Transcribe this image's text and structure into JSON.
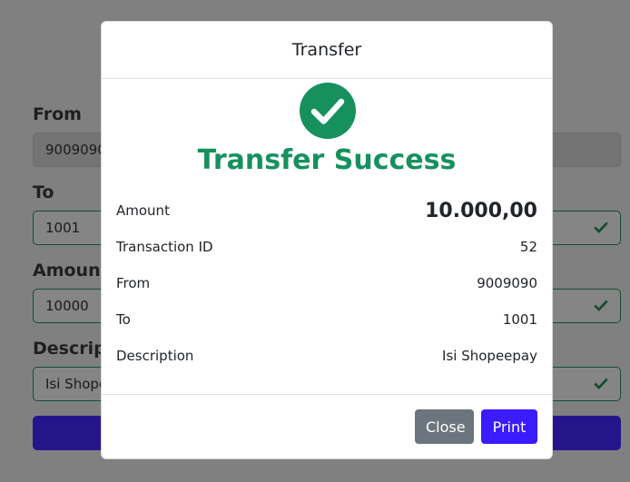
{
  "form": {
    "from_label": "From",
    "from_value": "9009090",
    "to_label": "To",
    "to_value": "1001",
    "amount_label": "Amount",
    "amount_value": "10000",
    "description_label": "Descripti",
    "description_value": "Isi Shope"
  },
  "modal": {
    "title": "Transfer",
    "success_icon": "check-circle-icon",
    "success_text": "Transfer Success",
    "details": {
      "amount_label": "Amount",
      "amount_value": "10.000,00",
      "transaction_id_label": "Transaction ID",
      "transaction_id_value": "52",
      "from_label": "From",
      "from_value": "9009090",
      "to_label": "To",
      "to_value": "1001",
      "description_label": "Description",
      "description_value": "Isi Shopeepay"
    },
    "close_label": "Close",
    "print_label": "Print"
  },
  "colors": {
    "success": "#16915e",
    "primary": "#3b1bff",
    "secondary": "#6c757d"
  }
}
